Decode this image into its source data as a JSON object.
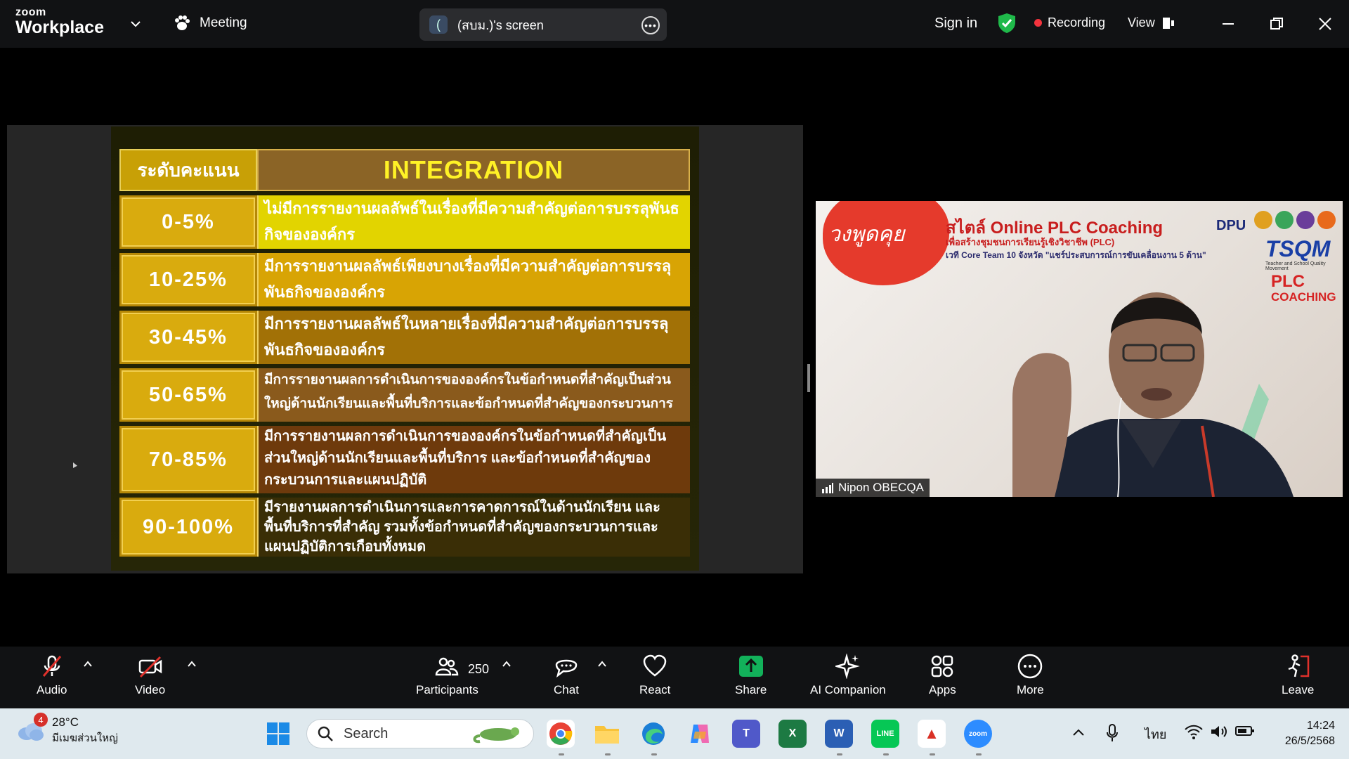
{
  "app": {
    "logo_small": "zoom",
    "logo_big": "Workplace",
    "meeting_label": "Meeting",
    "screen_share_label": "(สบม.)'s screen",
    "screen_share_bracket": "(",
    "sign_in": "Sign in",
    "recording": "Recording",
    "view": "View"
  },
  "slide": {
    "header_left": "ระดับคะแนน",
    "header_right": "INTEGRATION",
    "rows": [
      {
        "level": "0-5%",
        "desc": "ไม่มีการรายงานผลลัพธ์ในเรื่องที่มีความสำคัญต่อการบรรลุพันธกิจขององค์กร",
        "bg": "#e2d400"
      },
      {
        "level": "10-25%",
        "desc": "มีการรายงานผลลัพธ์เพียงบางเรื่องที่มีความสำคัญต่อการบรรลุพันธกิจขององค์กร",
        "bg": "#d8a404"
      },
      {
        "level": "30-45%",
        "desc": "มีการรายงานผลลัพธ์ในหลายเรื่องที่มีความสำคัญต่อการบรรลุพันธกิจขององค์กร",
        "bg": "#a27106"
      },
      {
        "level": "50-65%",
        "desc": "มีการรายงานผลการดำเนินการขององค์กรในข้อกำหนดที่สำคัญเป็นส่วนใหญ่ด้านนักเรียนและพื้นที่บริการและข้อกำหนดที่สำคัญของกระบวนการ",
        "bg": "#8a5a1c"
      },
      {
        "level": "70-85%",
        "desc": "มีการรายงานผลการดำเนินการขององค์กรในข้อกำหนดที่สำคัญเป็นส่วนใหญ่ด้านนักเรียนและพื้นที่บริการ และข้อกำหนดที่สำคัญของกระบวนการและแผนปฏิบัติ",
        "bg": "#6e3a0c"
      },
      {
        "level": "90-100%",
        "desc": "มีรายงานผลการดำเนินการและการคาดการณ์ในด้านนักเรียน และพื้นที่บริการที่สำคัญ รวมทั้งข้อกำหนดที่สำคัญของกระบวนการและแผนปฏิบัติการเกือบทั้งหมด",
        "bg": "#3a2e06"
      }
    ]
  },
  "video": {
    "badge": "วงพูดคุย",
    "title": "สไตล์ Online PLC Coaching",
    "sub1": "เพื่อสร้างชุมชนการเรียนรู้เชิงวิชาชีพ (PLC)",
    "sub2": "เวที Core Team 10 จังหวัด \"แชร์ประสบการณ์การขับเคลื่อนงาน 5 ด้าน\"",
    "dpu": "DPU",
    "tsqm": "TSQM",
    "tsqm_sub": "Teacher and School Quality Movement",
    "plc1": "PLC",
    "plc2": "COACHING",
    "participant_name": "Nipon OBECQA"
  },
  "toolbar": {
    "audio": "Audio",
    "video": "Video",
    "participants": "Participants",
    "participants_count": "250",
    "chat": "Chat",
    "react": "React",
    "share": "Share",
    "ai_companion": "AI Companion",
    "apps": "Apps",
    "more": "More",
    "leave": "Leave"
  },
  "taskbar": {
    "weather_badge": "4",
    "temp": "28°C",
    "weather_desc": "มีเมฆส่วนใหญ่",
    "search_placeholder": "Search",
    "language": "ไทย",
    "time": "14:24",
    "date": "26/5/2568"
  },
  "colors": {
    "topbar": "#111214",
    "recording_dot": "#f4333d",
    "share_green": "#12b15a",
    "accent_blue": "#2d8cff"
  }
}
